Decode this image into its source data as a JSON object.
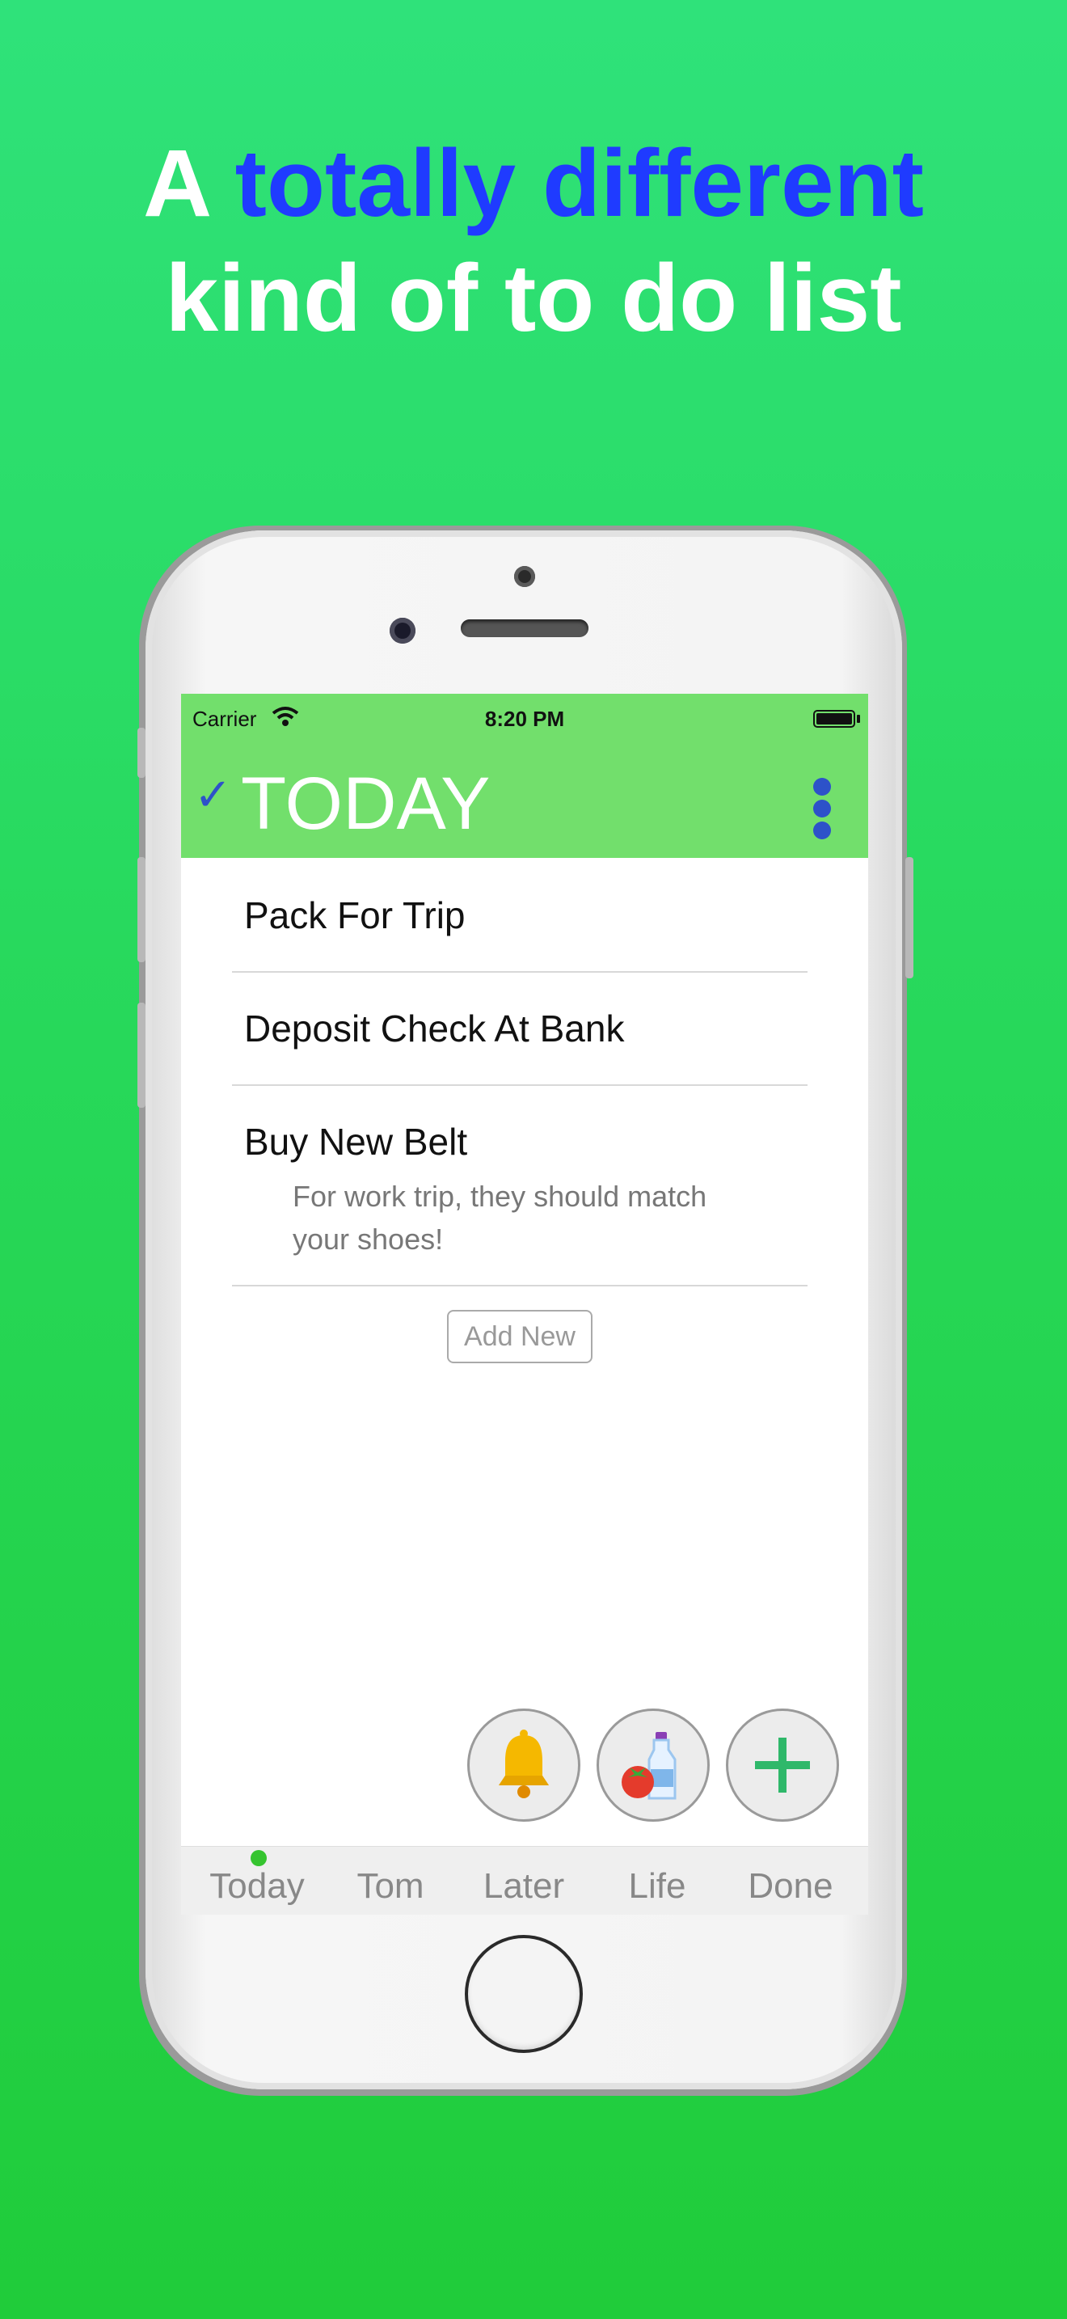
{
  "headline": {
    "line1_prefix": "A",
    "line1_accent": "totally different",
    "line2": "kind of to do list"
  },
  "status_bar": {
    "carrier": "Carrier",
    "time": "8:20 PM"
  },
  "header": {
    "title": "TODAY",
    "accent_color": "#2d52c9",
    "bar_color": "#72df6c"
  },
  "tasks": [
    {
      "title": "Pack For Trip"
    },
    {
      "title": "Deposit Check At Bank"
    },
    {
      "title": "Buy New Belt",
      "note": "For work trip, they should match your shoes!"
    }
  ],
  "add_new_label": "Add New",
  "action_buttons": [
    {
      "icon": "bell-icon"
    },
    {
      "icon": "grocery-icon"
    },
    {
      "icon": "plus-icon"
    }
  ],
  "tabs": [
    {
      "label": "Today",
      "active": true
    },
    {
      "label": "Tom"
    },
    {
      "label": "Later"
    },
    {
      "label": "Life"
    },
    {
      "label": "Done"
    }
  ]
}
